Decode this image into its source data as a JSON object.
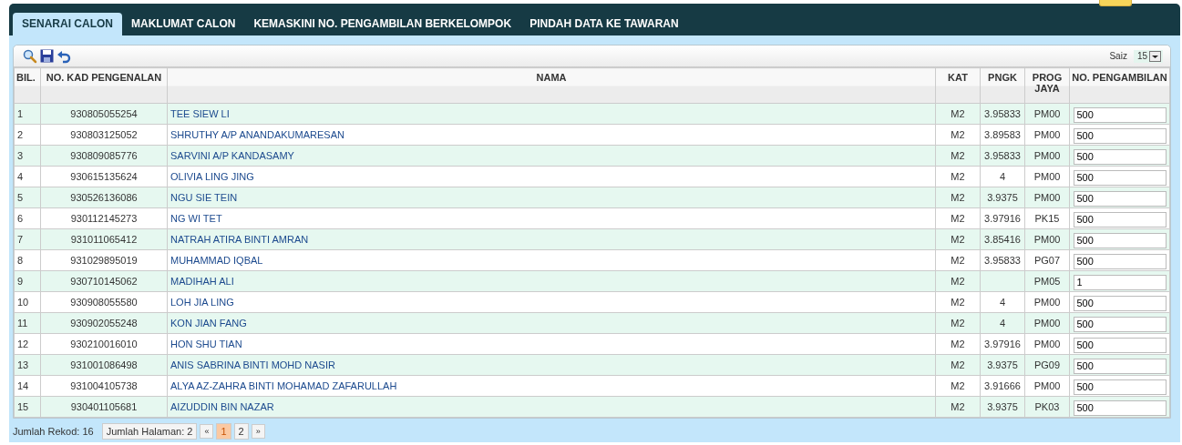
{
  "tabs": [
    {
      "label": "SENARAI CALON",
      "selected": true
    },
    {
      "label": "MAKLUMAT CALON",
      "selected": false
    },
    {
      "label": "KEMASKINI NO. PENGAMBILAN BERKELOMPOK",
      "selected": false
    },
    {
      "label": "PINDAH DATA KE TAWARAN",
      "selected": false
    }
  ],
  "page_size": {
    "label": "Saiz",
    "value": "15"
  },
  "table": {
    "columns": [
      {
        "label": "BIL."
      },
      {
        "label": "NO. KAD PENGENALAN"
      },
      {
        "label": "NAMA"
      },
      {
        "label": "KAT"
      },
      {
        "label": "PNGK"
      },
      {
        "label": "PROG JAYA"
      },
      {
        "label": "NO. PENGAMBILAN"
      }
    ],
    "rows": [
      {
        "bil": "1",
        "ic": "930805055254",
        "nama": "TEE SIEW LI",
        "kat": "M2",
        "pngk": "3.95833",
        "prog": "PM00",
        "pengambilan": "500"
      },
      {
        "bil": "2",
        "ic": "930803125052",
        "nama": "SHRUTHY A/P ANANDAKUMARESAN",
        "kat": "M2",
        "pngk": "3.89583",
        "prog": "PM00",
        "pengambilan": "500"
      },
      {
        "bil": "3",
        "ic": "930809085776",
        "nama": "SARVINI A/P KANDASAMY",
        "kat": "M2",
        "pngk": "3.95833",
        "prog": "PM00",
        "pengambilan": "500"
      },
      {
        "bil": "4",
        "ic": "930615135624",
        "nama": "OLIVIA LING JING",
        "kat": "M2",
        "pngk": "4",
        "prog": "PM00",
        "pengambilan": "500"
      },
      {
        "bil": "5",
        "ic": "930526136086",
        "nama": "NGU SIE TEIN",
        "kat": "M2",
        "pngk": "3.9375",
        "prog": "PM00",
        "pengambilan": "500"
      },
      {
        "bil": "6",
        "ic": "930112145273",
        "nama": "NG WI TET",
        "kat": "M2",
        "pngk": "3.97916",
        "prog": "PK15",
        "pengambilan": "500"
      },
      {
        "bil": "7",
        "ic": "931011065412",
        "nama": "NATRAH ATIRA BINTI AMRAN",
        "kat": "M2",
        "pngk": "3.85416",
        "prog": "PM00",
        "pengambilan": "500"
      },
      {
        "bil": "8",
        "ic": "931029895019",
        "nama": "MUHAMMAD IQBAL",
        "kat": "M2",
        "pngk": "3.95833",
        "prog": "PG07",
        "pengambilan": "500"
      },
      {
        "bil": "9",
        "ic": "930710145062",
        "nama": "MADIHAH ALI",
        "kat": "M2",
        "prog": "PM05",
        "pengambilan": "1"
      },
      {
        "bil": "10",
        "ic": "930908055580",
        "nama": "LOH JIA LING",
        "kat": "M2",
        "pngk": "4",
        "prog": "PM00",
        "pengambilan": "500"
      },
      {
        "bil": "11",
        "ic": "930902055248",
        "nama": "KON JIAN FANG",
        "kat": "M2",
        "pngk": "4",
        "prog": "PM00",
        "pengambilan": "500"
      },
      {
        "bil": "12",
        "ic": "930210016010",
        "nama": "HON SHU TIAN",
        "kat": "M2",
        "pngk": "3.97916",
        "prog": "PM00",
        "pengambilan": "500"
      },
      {
        "bil": "13",
        "ic": "931001086498",
        "nama": "ANIS SABRINA BINTI MOHD NASIR",
        "kat": "M2",
        "pngk": "3.9375",
        "prog": "PG09",
        "pengambilan": "500"
      },
      {
        "bil": "14",
        "ic": "931004105738",
        "nama": "ALYA AZ-ZAHRA BINTI MOHAMAD ZAFARULLAH",
        "kat": "M2",
        "pngk": "3.91666",
        "prog": "PM00",
        "pengambilan": "500"
      },
      {
        "bil": "15",
        "ic": "930401105681",
        "nama": "AIZUDDIN BIN NAZAR",
        "kat": "M2",
        "pngk": "3.9375",
        "prog": "PK03",
        "pengambilan": "500"
      }
    ]
  },
  "pager": {
    "record_count": "Jumlah Rekod: 16",
    "page_count": "Jumlah Halaman: 2",
    "prev": "«",
    "pages": [
      {
        "label": "1",
        "selected": true
      },
      {
        "label": "2",
        "selected": false
      }
    ],
    "next": "»"
  }
}
